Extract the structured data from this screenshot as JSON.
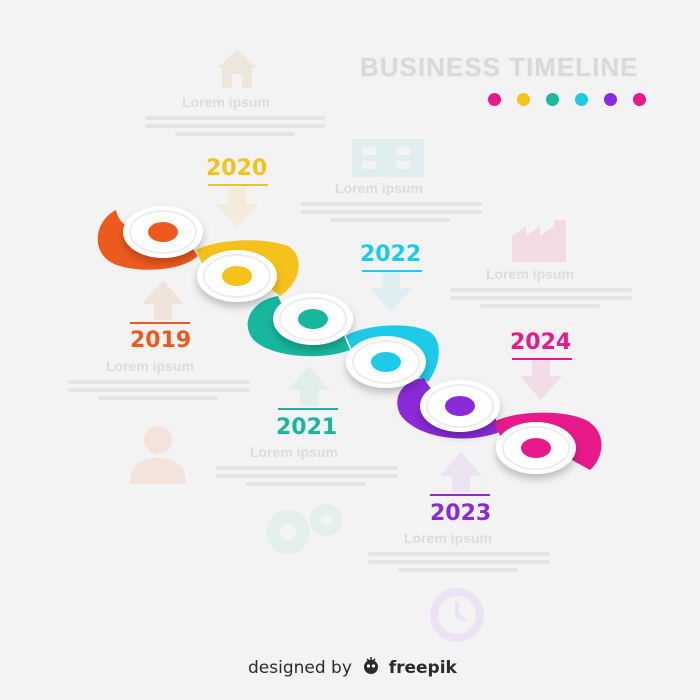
{
  "title": "BUSINESS TIMELINE",
  "palette_dots": [
    "#e8198b",
    "#f5c518",
    "#19b99a",
    "#1fc8e3",
    "#8a2be2",
    "#e8198b"
  ],
  "milestones": [
    {
      "year": "2019",
      "color": "#ec5a1e",
      "heading": "Lorem ipsum",
      "icon": "person-icon"
    },
    {
      "year": "2020",
      "color": "#f5c21b",
      "heading": "Lorem ipsum",
      "icon": "house-icon"
    },
    {
      "year": "2021",
      "color": "#17b79d",
      "heading": "Lorem ipsum",
      "icon": "gears-icon"
    },
    {
      "year": "2022",
      "color": "#1dcbe8",
      "heading": "Lorem ipsum",
      "icon": "presentation-icon"
    },
    {
      "year": "2023",
      "color": "#8b2ad8",
      "heading": "Lorem ipsum",
      "icon": "clock-icon"
    },
    {
      "year": "2024",
      "color": "#e8198b",
      "heading": "Lorem ipsum",
      "icon": "factory-icon"
    }
  ],
  "credit": {
    "prefix": "designed by",
    "brand": "freepik"
  }
}
